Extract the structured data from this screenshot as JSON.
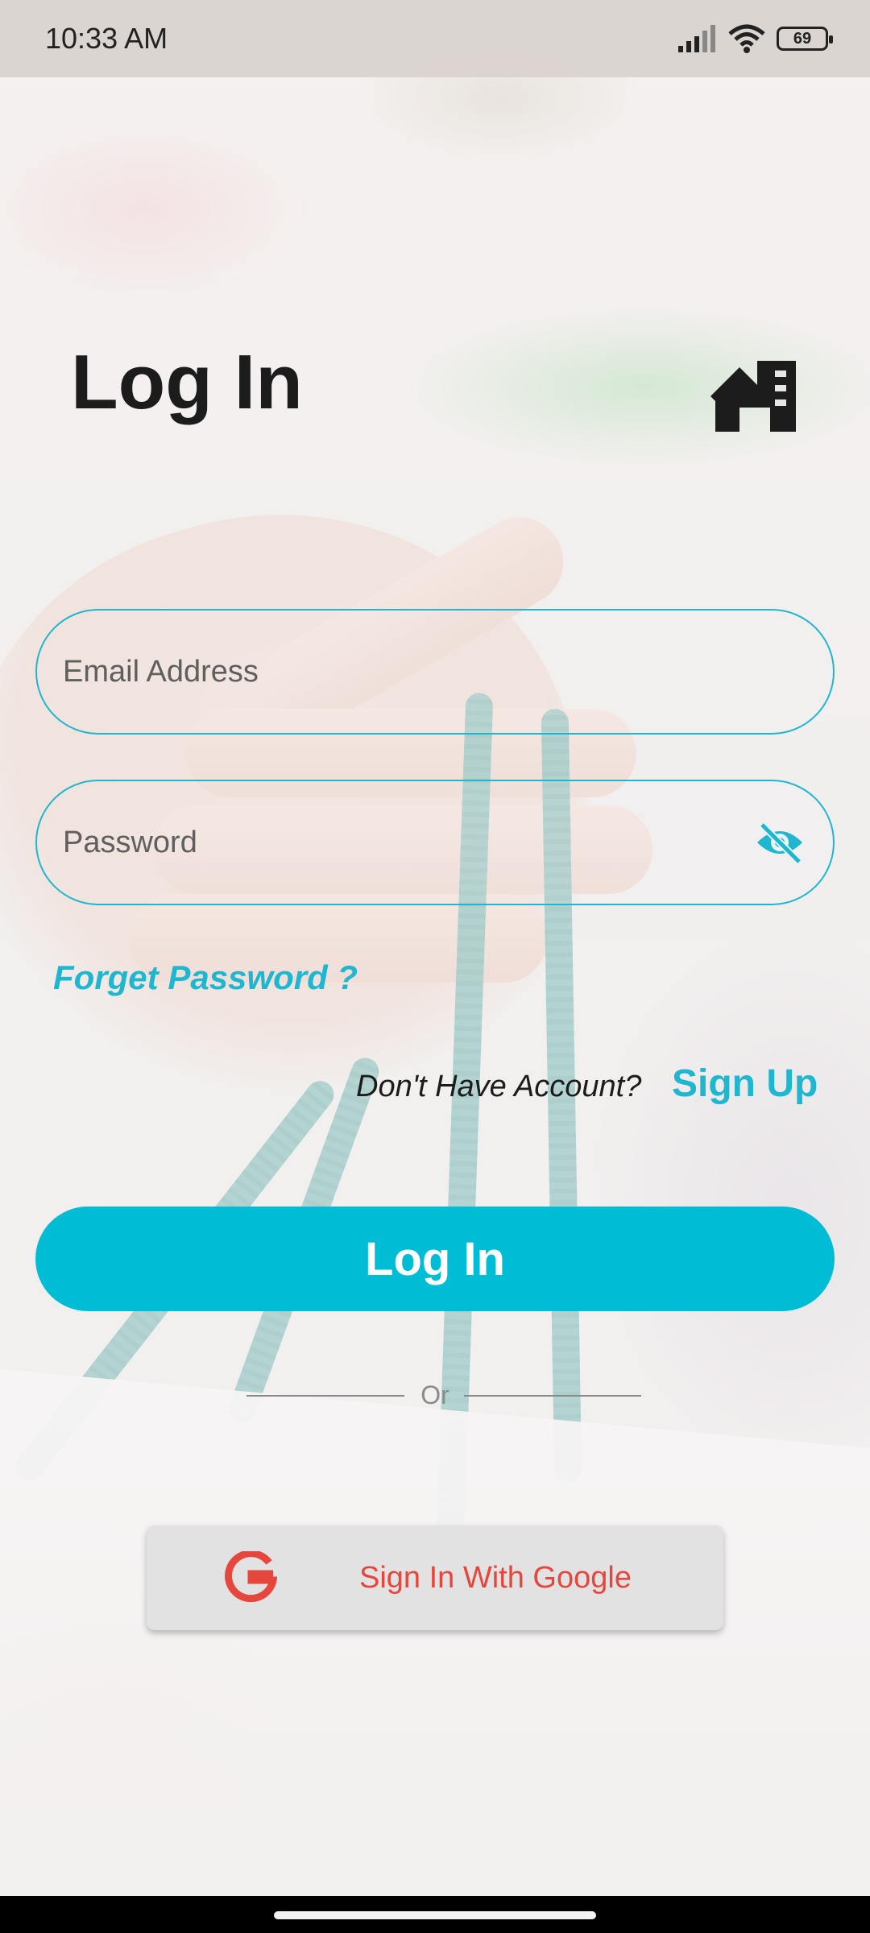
{
  "status_bar": {
    "time": "10:33 AM",
    "battery": "69",
    "icons": [
      "signal-icon",
      "wifi-icon",
      "battery-icon"
    ]
  },
  "header": {
    "title": "Log In",
    "logo_icon": "house-store-icon"
  },
  "form": {
    "email_placeholder": "Email Address",
    "email_value": "",
    "password_placeholder": "Password",
    "password_value": "",
    "password_visibility_icon": "eye-off-icon",
    "forgot_label": "Forget Password ?"
  },
  "signup_prompt": {
    "text": "Don't Have Account?",
    "link": "Sign Up"
  },
  "actions": {
    "login_label": "Log In",
    "divider_text": "Or",
    "google_label": "Sign In With Google",
    "google_icon": "google-g-icon"
  },
  "colors": {
    "accent": "#00bcd4",
    "link": "#1fb6cf",
    "google_text": "#e5473c",
    "text_dark": "#1c1c1c"
  }
}
